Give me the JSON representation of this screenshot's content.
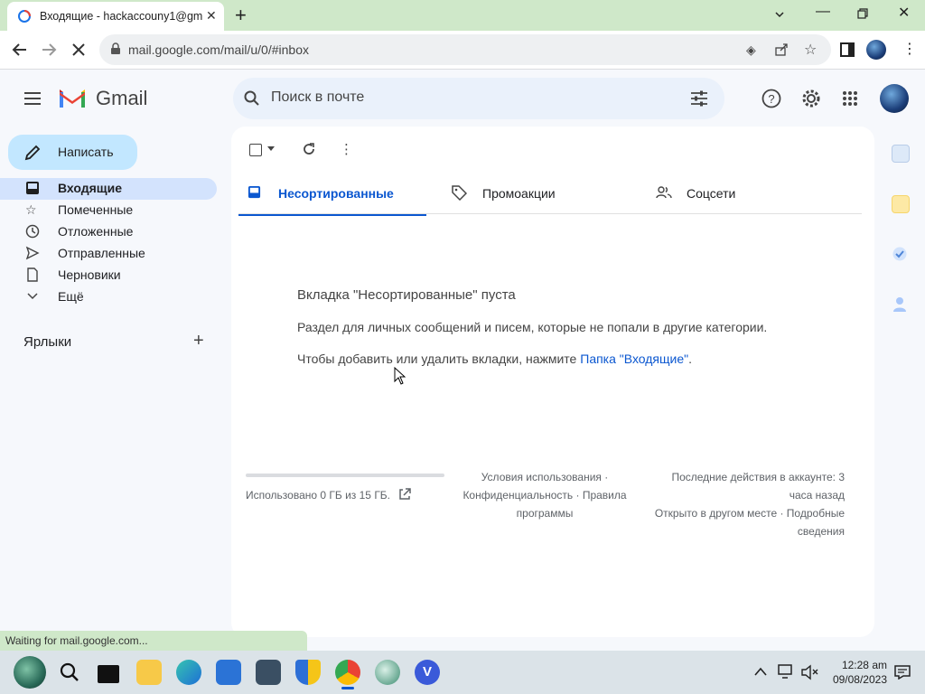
{
  "browser": {
    "tab_title": "Входящие - hackaccouny1@gma",
    "url": "mail.google.com/mail/u/0/#inbox",
    "status_text": "Waiting for mail.google.com..."
  },
  "gmail": {
    "logo_text": "Gmail",
    "search_placeholder": "Поиск в почте",
    "compose_label": "Написать",
    "nav": [
      {
        "label": "Входящие",
        "icon": "inbox-icon",
        "active": true
      },
      {
        "label": "Помеченные",
        "icon": "star-icon"
      },
      {
        "label": "Отложенные",
        "icon": "clock-icon"
      },
      {
        "label": "Отправленные",
        "icon": "send-icon"
      },
      {
        "label": "Черновики",
        "icon": "draft-icon"
      },
      {
        "label": "Ещё",
        "icon": "chevron-down-icon"
      }
    ],
    "labels_title": "Ярлыки",
    "tabs": [
      {
        "label": "Несортированные",
        "icon": "inbox-icon",
        "active": true
      },
      {
        "label": "Промоакции",
        "icon": "tag-icon"
      },
      {
        "label": "Соцсети",
        "icon": "people-icon"
      }
    ],
    "empty_state": {
      "title": "Вкладка \"Несортированные\" пуста",
      "description": "Раздел для личных сообщений и писем, которые не попали в другие категории.",
      "hint_prefix": "Чтобы добавить или удалить вкладки, нажмите ",
      "hint_link": "Папка \"Входящие\"",
      "hint_suffix": "."
    },
    "footer": {
      "storage_text": "Использовано 0 ГБ из 15 ГБ.",
      "storage_used_fraction": 0.0,
      "terms_line1": "Условия использования ·",
      "terms_line2": "Конфиденциальность · Правила",
      "terms_line3": "программы",
      "activity_line1": "Последние действия в аккаунте: 3",
      "activity_line2": "часа назад",
      "activity_line3": "Открыто в другом месте · Подробные",
      "activity_line4": "сведения"
    }
  },
  "taskbar": {
    "time": "12:28 am",
    "date": "09/08/2023"
  },
  "colors": {
    "accent": "#0b57d0",
    "compose_bg": "#c2e7ff",
    "active_nav_bg": "#d3e3fd",
    "chrome_tabstrip": "#cfe8c9"
  }
}
